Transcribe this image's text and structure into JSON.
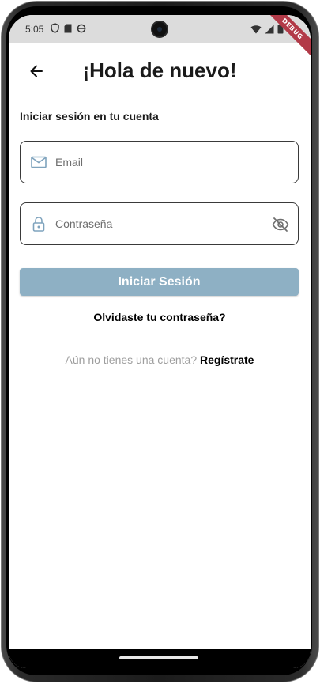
{
  "status_bar": {
    "time": "5:05",
    "debug_label": "DEBUG",
    "icons_left": [
      "shield-icon",
      "sim-card-icon",
      "sync-icon"
    ],
    "icons_right": [
      "wifi-icon",
      "signal-icon",
      "battery-icon"
    ]
  },
  "header": {
    "title": "¡Hola de nuevo!",
    "back_icon": "arrow-left-icon"
  },
  "form": {
    "subtitle": "Iniciar sesión en tu cuenta",
    "email_placeholder": "Email",
    "password_placeholder": "Contraseña",
    "login_label": "Iniciar Sesión",
    "forgot_label": "Olvidaste tu contraseña?",
    "register_prompt": "Aún no tienes una cuenta?",
    "register_link": "Regístrate"
  },
  "colors": {
    "primary_button": "#8eb0c4",
    "icon_accent": "#7fa3bd",
    "debug_banner": "#b23a48"
  }
}
